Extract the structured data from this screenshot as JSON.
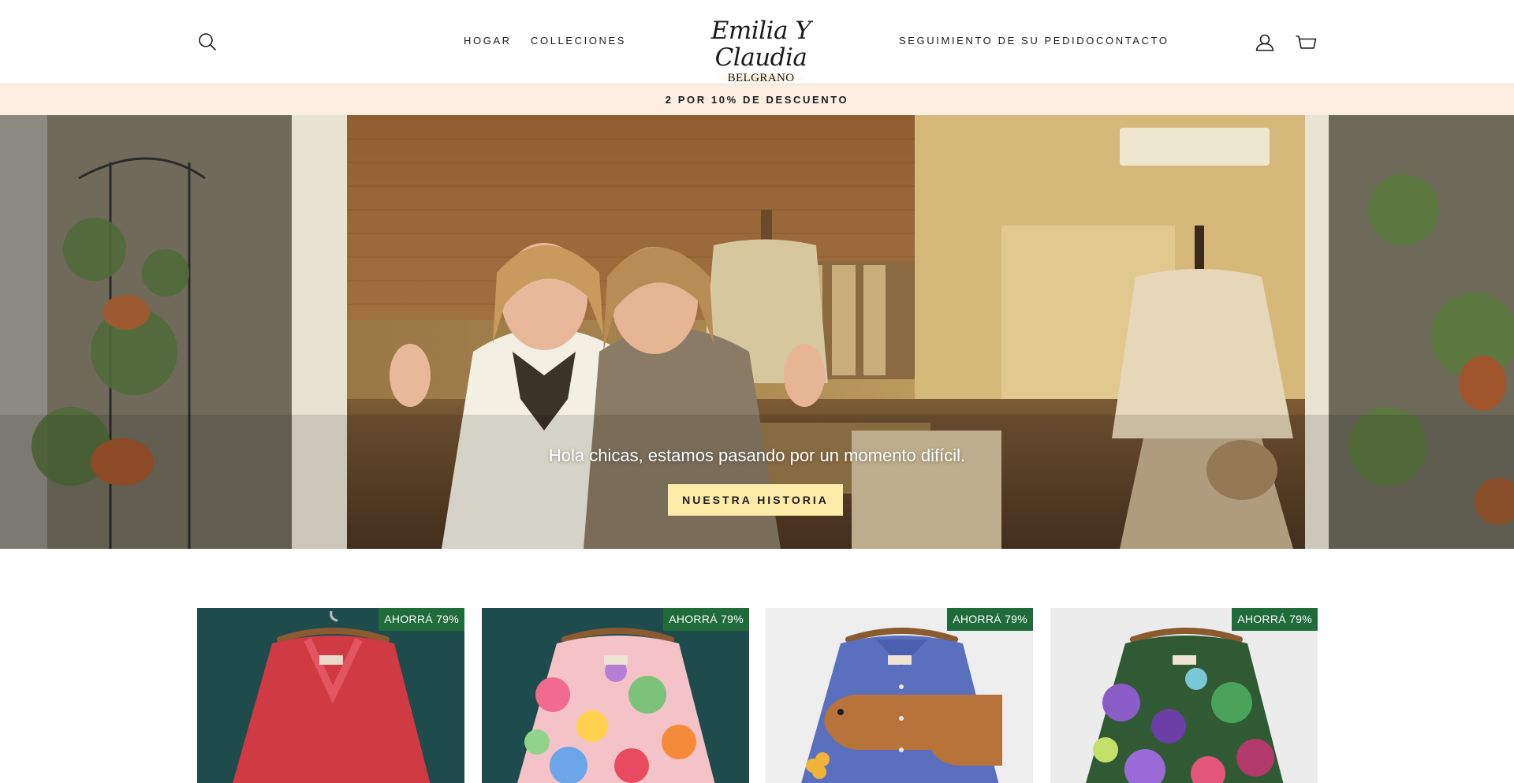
{
  "header": {
    "nav_left": [
      {
        "label": "HOGAR"
      },
      {
        "label": "COLLECIONES"
      }
    ],
    "nav_right": [
      {
        "label": "SEGUIMIENTO DE SU PEDIDO"
      },
      {
        "label": "CONTACTO"
      }
    ],
    "logo": {
      "script": "Emilia Y Claudia",
      "sub": "BELGRANO"
    },
    "icons": {
      "search": "search-icon",
      "account": "account-icon",
      "cart": "cart-icon"
    }
  },
  "announcement": {
    "text": "2 POR 10% DE DESCUENTO"
  },
  "hero": {
    "text": "Hola chicas, estamos pasando por un momento difícil.",
    "button_label": "NUESTRA HISTORIA"
  },
  "products": [
    {
      "badge": "AHORRÁ 79%",
      "image": "red-ruffled-blouse"
    },
    {
      "badge": "AHORRÁ 79%",
      "image": "floral-print-blouse"
    },
    {
      "badge": "AHORRÁ 79%",
      "image": "blue-dog-print-shirt"
    },
    {
      "badge": "AHORRÁ 79%",
      "image": "purple-floral-shirt"
    }
  ],
  "colors": {
    "announcement_bg": "#fdeee2",
    "hero_button_bg": "#fdeca9",
    "badge_bg": "#1f6b3a"
  }
}
